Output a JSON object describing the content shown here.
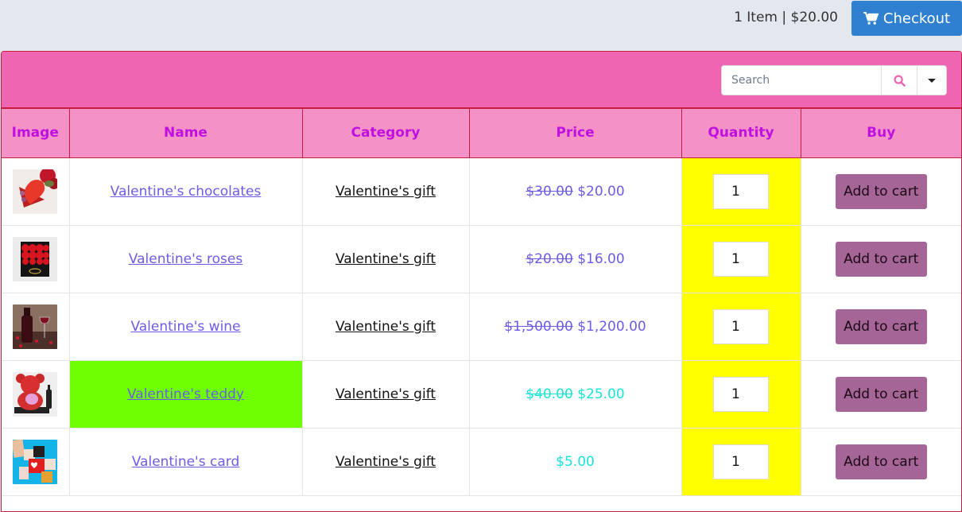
{
  "topbar": {
    "cart_summary": "1 Item | $20.00",
    "checkout_label": "Checkout",
    "checkout_icon": "shopping-cart-icon",
    "checkout_color": "#2f80d1"
  },
  "search": {
    "placeholder": "Search",
    "value": "",
    "search_icon": "search-icon",
    "dropdown_icon": "caret-down-icon"
  },
  "colors": {
    "header_bg": "#ee66b1",
    "column_header_bg": "#f492c8",
    "column_header_text": "#c010e0",
    "border_accent": "#c81d3a",
    "quantity_bg": "#ffff00",
    "highlight_bg": "#6fff00",
    "add_button_bg": "#a56597",
    "price_purple": "#6b5ce7",
    "price_cyan": "#19e4d8"
  },
  "table": {
    "columns": [
      "Image",
      "Name",
      "Category",
      "Price",
      "Quantity",
      "Buy"
    ],
    "rows": [
      {
        "image": "chocolates-image",
        "name": "Valentine's chocolates",
        "category": "Valentine's gift",
        "old_price": "$30.00",
        "price": "$20.00",
        "price_color": "purple",
        "quantity": "1",
        "buy_label": "Add to cart",
        "highlight": false
      },
      {
        "image": "roses-image",
        "name": "Valentine's roses",
        "category": "Valentine's gift",
        "old_price": "$20.00",
        "price": "$16.00",
        "price_color": "purple",
        "quantity": "1",
        "buy_label": "Add to cart",
        "highlight": false
      },
      {
        "image": "wine-image",
        "name": "Valentine's wine",
        "category": "Valentine's gift",
        "old_price": "$1,500.00",
        "price": "$1,200.00",
        "price_color": "purple",
        "quantity": "1",
        "buy_label": "Add to cart",
        "highlight": false
      },
      {
        "image": "teddy-image",
        "name": "Valentine's teddy",
        "category": "Valentine's gift",
        "old_price": "$40.00",
        "price": "$25.00",
        "price_color": "cyan",
        "quantity": "1",
        "buy_label": "Add to cart",
        "highlight": true
      },
      {
        "image": "card-image",
        "name": "Valentine's card",
        "category": "Valentine's gift",
        "old_price": "",
        "price": "$5.00",
        "price_color": "cyan",
        "quantity": "1",
        "buy_label": "Add to cart",
        "highlight": false
      }
    ]
  }
}
